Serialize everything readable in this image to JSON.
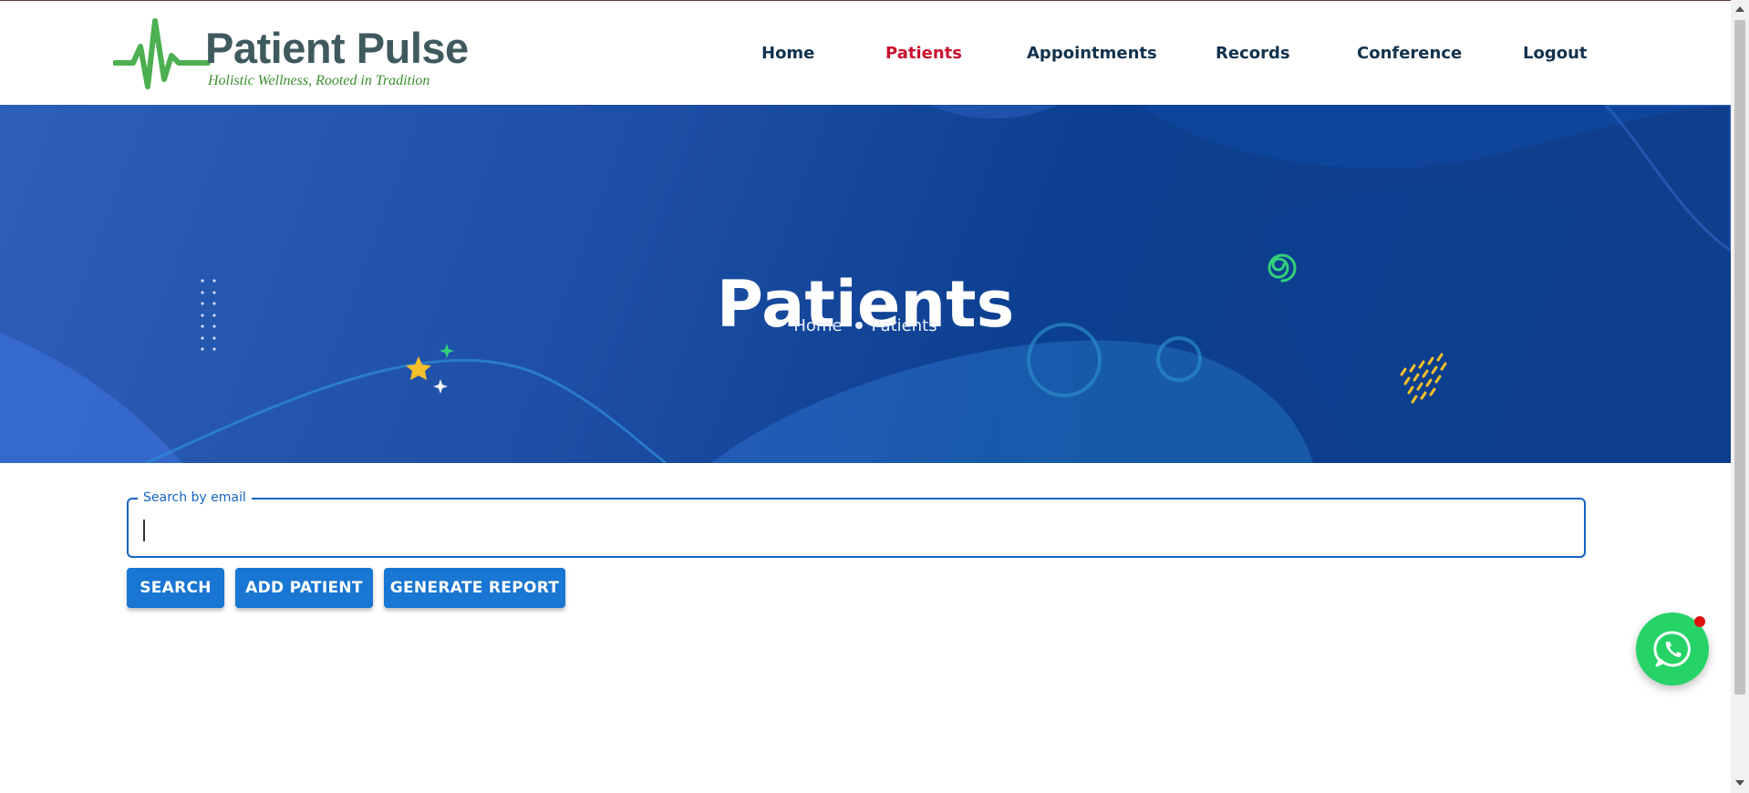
{
  "brand": {
    "name": "Patient Pulse",
    "tagline": "Holistic Wellness, Rooted in Tradition",
    "color_text": "#3f5a5f",
    "color_accent": "#3a8f2e"
  },
  "nav": {
    "items": [
      {
        "label": "Home"
      },
      {
        "label": "Patients",
        "active": true
      },
      {
        "label": "Appointments"
      },
      {
        "label": "Records"
      },
      {
        "label": "Conference"
      },
      {
        "label": "Logout"
      }
    ],
    "active_color": "#c8102e"
  },
  "hero": {
    "title": "Patients",
    "breadcrumb": [
      "Home",
      "Patients"
    ]
  },
  "search": {
    "label": "Search by email",
    "value": ""
  },
  "actions": {
    "search": "SEARCH",
    "add_patient": "ADD PATIENT",
    "generate_report": "GENERATE REPORT"
  },
  "chat_widget": {
    "icon": "whatsapp-icon",
    "notification": true
  },
  "colors": {
    "primary": "#1976d2",
    "hero_blue": "#1e4fa6"
  }
}
